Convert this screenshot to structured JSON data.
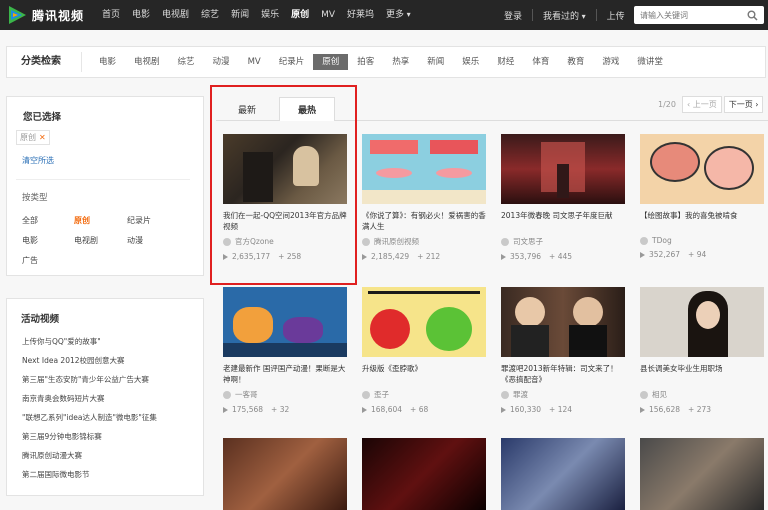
{
  "brand": {
    "name": "腾讯视频"
  },
  "nav": [
    "首页",
    "电影",
    "电视剧",
    "综艺",
    "新闻",
    "娱乐",
    "原创",
    "MV",
    "好莱坞",
    "更多"
  ],
  "nav_active": 6,
  "top_right": {
    "login": "登录",
    "history": "我看过的",
    "upload": "上传"
  },
  "search": {
    "placeholder": "请输入关键词"
  },
  "category": {
    "title": "分类检索",
    "items": [
      "电影",
      "电视剧",
      "综艺",
      "动漫",
      "MV",
      "纪录片",
      "原创",
      "拍客",
      "热享",
      "新闻",
      "娱乐",
      "财经",
      "体育",
      "教育",
      "游戏",
      "微讲堂"
    ],
    "active": 6
  },
  "sidebar": {
    "selected_title": "您已选择",
    "selected_tag": "原创",
    "clear": "清空所选",
    "type_label": "按类型",
    "types": [
      "全部",
      "原创",
      "纪录片",
      "电影",
      "电视剧",
      "动漫",
      "广告"
    ],
    "active_type": 1,
    "activity_title": "活动视频",
    "activities": [
      "上传你与QQ\"爱的故事\"",
      "Next Idea 2012校园创意大赛",
      "第三届\"生态安防\"青少年公益广告大赛",
      "南京青奥会数码短片大赛",
      "\"联想乙系列\"idea达人制造\"微电影\"征集",
      "第三届9分钟电影锦标赛",
      "腾讯原创动漫大赛",
      "第二届国际微电影节"
    ]
  },
  "tabs": {
    "new": "最新",
    "hot": "最热"
  },
  "pager": {
    "page": "1/20",
    "prev": "上一页",
    "next": "下一页"
  },
  "videos": [
    {
      "title": "我们在一起-QQ空间2013年官方品牌视频",
      "author": "官方Qzone",
      "plays": "2,635,177",
      "comments": "258"
    },
    {
      "title": "《你说了算》：有钢必火！爱祸害的香满人生",
      "author": "腾讯原创视频",
      "plays": "2,185,429",
      "comments": "212"
    },
    {
      "title": "2013年微春晚 司文思子年度巨献",
      "author": "司文思子",
      "plays": "353,796",
      "comments": "445"
    },
    {
      "title": "【绘图故事】我的喜兔被啃食",
      "author": "TDog",
      "plays": "352,267",
      "comments": "94"
    },
    {
      "title": "老建最新作 国评国产动漫！果断是大神啊！",
      "author": "一客哥",
      "plays": "175,568",
      "comments": "32"
    },
    {
      "title": "升级版《歪脖歌》",
      "author": "歪子",
      "plays": "168,604",
      "comments": "68"
    },
    {
      "title": "罪渡吧2013新年特辑：司文来了！《恶搞配音》",
      "author": "罪渡",
      "plays": "160,330",
      "comments": "124"
    },
    {
      "title": "县长调美女毕业生用职场",
      "author": "相见",
      "plays": "156,628",
      "comments": "273"
    }
  ],
  "colors": {
    "topbar": "#262626",
    "accent": "#f36b0f",
    "highlight": "#e02020",
    "link": "#2a6fb6"
  }
}
